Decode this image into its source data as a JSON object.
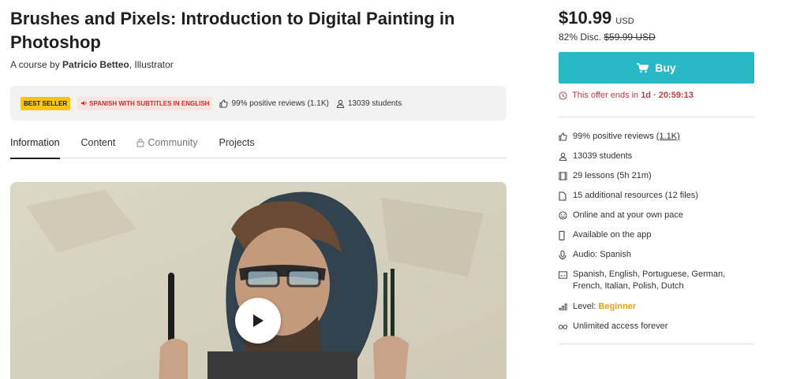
{
  "course": {
    "title": "Brushes and Pixels: Introduction to Digital Painting in Photoshop",
    "byline_prefix": "A course by",
    "author": "Patricio Betteo",
    "author_role": ", Illustrator"
  },
  "infobar": {
    "badge_best": "BEST SELLER",
    "badge_lang": "SPANISH WITH SUBTITLES IN ENGLISH",
    "reviews": "99% positive reviews (1.1K)",
    "students": "13039 students"
  },
  "tabs": [
    {
      "label": "Information",
      "active": true
    },
    {
      "label": "Content"
    },
    {
      "label": "Community",
      "locked": true
    },
    {
      "label": "Projects"
    }
  ],
  "pricing": {
    "price": "$10.99",
    "currency": "USD",
    "discount_label": "82% Disc.",
    "original_price": "$59.99 USD",
    "buy_label": "Buy",
    "offer_prefix": "This offer ends in",
    "offer_time": "1d · 20:59:13"
  },
  "features": {
    "reviews": "99% positive reviews",
    "reviews_count": "(1.1K)",
    "students": "13039 students",
    "lessons": "29 lessons (5h 21m)",
    "resources": "15 additional resources (12 files)",
    "pace": "Online and at your own pace",
    "app": "Available on the app",
    "audio": "Audio: Spanish",
    "subtitles": "Spanish, English, Portuguese, German, French, Italian, Polish, Dutch",
    "level_label": "Level:",
    "level_value": "Beginner",
    "access": "Unlimited access forever"
  },
  "colors": {
    "buy": "#28b8c6",
    "offer": "#c23b3b",
    "badge_best": "#f8c41b",
    "level": "#e5a21c"
  }
}
